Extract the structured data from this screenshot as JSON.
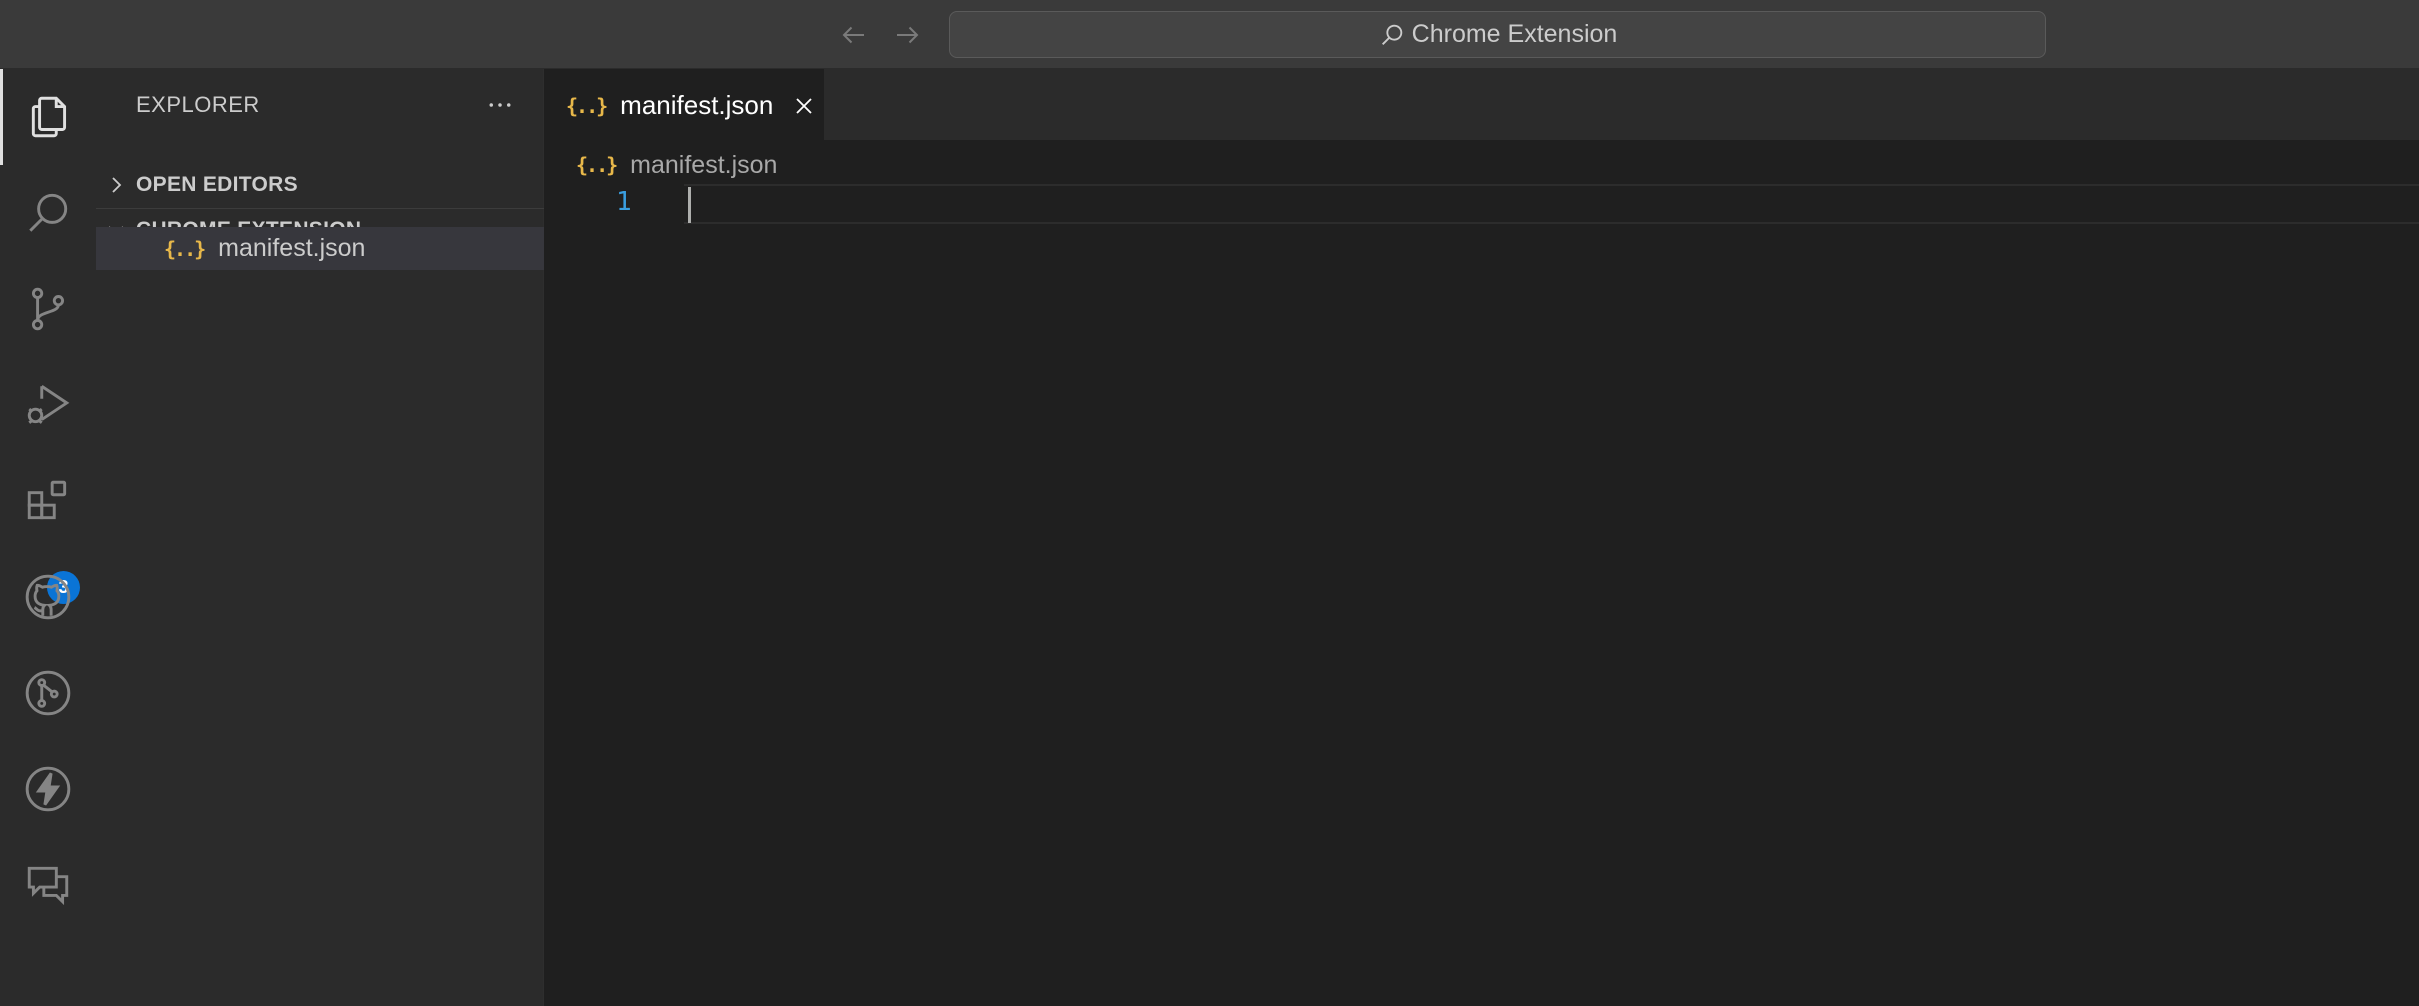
{
  "titlebar": {
    "search_text": "Chrome Extension",
    "back_icon": "arrow-left-icon",
    "forward_icon": "arrow-right-icon"
  },
  "activity_bar": {
    "items": [
      {
        "name": "explorer",
        "icon": "files-icon",
        "active": true
      },
      {
        "name": "search",
        "icon": "search-icon"
      },
      {
        "name": "source-control",
        "icon": "source-control-icon"
      },
      {
        "name": "run-debug",
        "icon": "run-debug-icon"
      },
      {
        "name": "extensions",
        "icon": "extensions-icon",
        "badge": "3"
      },
      {
        "name": "github",
        "icon": "github-icon"
      },
      {
        "name": "git-graph",
        "icon": "git-graph-icon"
      },
      {
        "name": "lightning",
        "icon": "lightning-icon"
      },
      {
        "name": "comments",
        "icon": "comments-icon"
      }
    ],
    "extensions_badge": "3"
  },
  "sidebar": {
    "title": "EXPLORER",
    "more_icon": "ellipsis-icon",
    "sections": {
      "open_editors": "OPEN EDITORS",
      "chrome_extension": "CHROME EXTENSION"
    },
    "files": [
      {
        "name": "manifest.json",
        "icon": "{..}"
      }
    ]
  },
  "editor": {
    "tab_label": "manifest.json",
    "tab_icon": "{..}",
    "breadcrumb": "manifest.json",
    "line_numbers": [
      "1"
    ]
  },
  "colors": {
    "json_icon": "#e8b84a",
    "line_number": "#3a9ee0",
    "badge": "#0a74d6"
  }
}
